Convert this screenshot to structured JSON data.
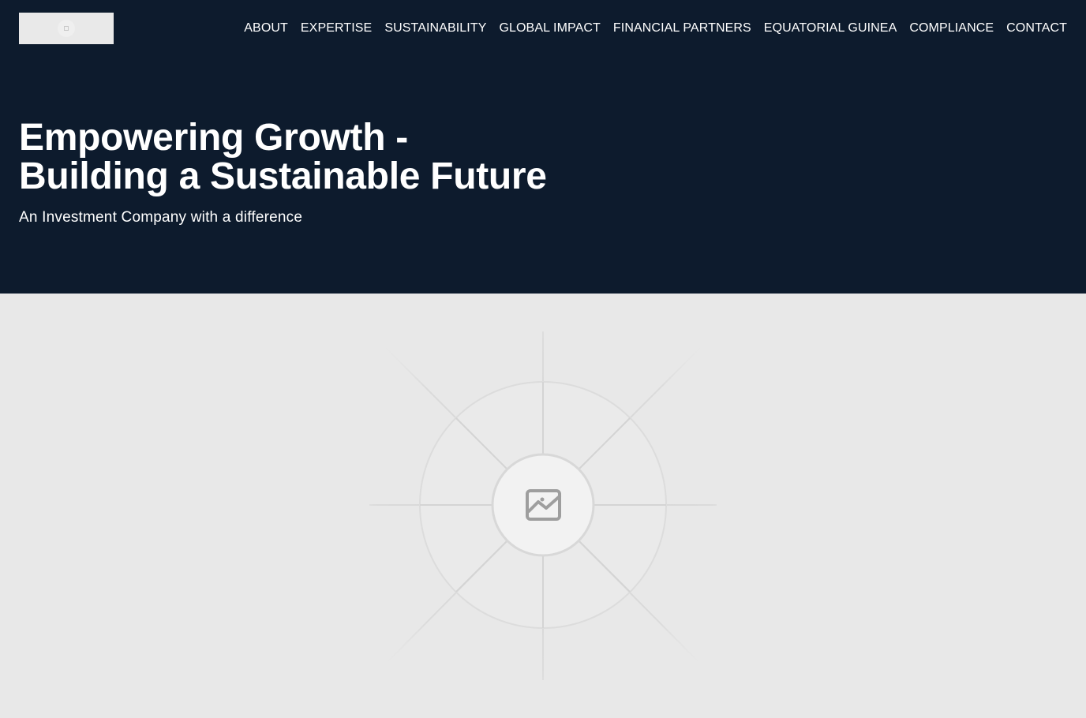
{
  "header": {
    "logo_alt": "",
    "nav": [
      {
        "label": "ABOUT"
      },
      {
        "label": "EXPERTISE"
      },
      {
        "label": "SUSTAINABILITY"
      },
      {
        "label": "GLOBAL IMPACT"
      },
      {
        "label": "FINANCIAL PARTNERS"
      },
      {
        "label": "EQUATORIAL GUINEA"
      },
      {
        "label": "COMPLIANCE"
      },
      {
        "label": "CONTACT"
      }
    ]
  },
  "hero": {
    "title_line1": "Empowering Growth -",
    "title_line2": "Building a Sustainable Future",
    "subtitle": "An Investment Company with a difference"
  },
  "media": {
    "icon": "image-placeholder-icon"
  },
  "colors": {
    "hero_background": "#0d1b2d",
    "hero_text": "#ffffff",
    "placeholder_background": "#e8e8e8"
  }
}
